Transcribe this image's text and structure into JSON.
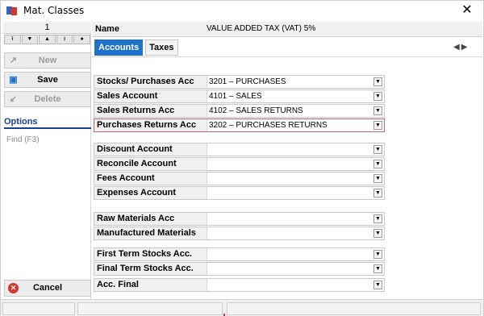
{
  "window": {
    "title": "Mat. Classes"
  },
  "left": {
    "record_number": "1",
    "nav_buttons": [
      "⭱",
      "▼",
      "▲",
      "⭳",
      "●"
    ],
    "new_label": "New",
    "save_label": "Save",
    "delete_label": "Delete",
    "options_heading": "Options",
    "find_label": "Find  (F3)",
    "cancel_label": "Cancel"
  },
  "header": {
    "name_label": "Name",
    "name_value": "VALUE ADDED TAX (VAT) 5%"
  },
  "tabs": [
    {
      "label": "Accounts",
      "active": true
    },
    {
      "label": "Taxes",
      "active": false
    }
  ],
  "fields": [
    {
      "label": "Stocks/ Purchases Acc",
      "value": "3201 – PURCHASES"
    },
    {
      "label": "Sales Account",
      "value": "4101 – SALES"
    },
    {
      "label": "Sales Returns Acc",
      "value": "4102 – SALES RETURNS"
    },
    {
      "label": "Purchases Returns Acc",
      "value": "3202 – PURCHASES RETURNS"
    },
    {
      "label": "Discount Account",
      "value": ""
    },
    {
      "label": "Reconcile Account",
      "value": ""
    },
    {
      "label": "Fees Account",
      "value": ""
    },
    {
      "label": "Expenses Account",
      "value": ""
    },
    {
      "label": "Raw Materials Acc",
      "value": ""
    },
    {
      "label": "Manufactured Materials",
      "value": ""
    },
    {
      "label": "First Term Stocks Acc.",
      "value": ""
    },
    {
      "label": "Final Term Stocks Acc.",
      "value": ""
    },
    {
      "label": "Acc. Final",
      "value": ""
    }
  ],
  "colors": {
    "accent": "#1e73c8",
    "options_heading": "#1b3f8f",
    "cancel_icon": "#d9342b"
  }
}
